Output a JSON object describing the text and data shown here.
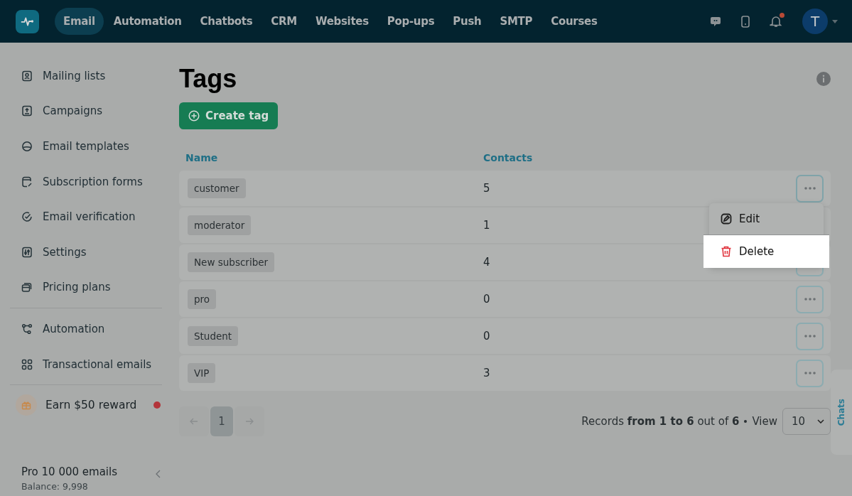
{
  "nav": [
    {
      "label": "Email",
      "selected": true
    },
    {
      "label": "Automation",
      "selected": false
    },
    {
      "label": "Chatbots",
      "selected": false
    },
    {
      "label": "CRM",
      "selected": false
    },
    {
      "label": "Websites",
      "selected": false
    },
    {
      "label": "Pop-ups",
      "selected": false
    },
    {
      "label": "Push",
      "selected": false
    },
    {
      "label": "SMTP",
      "selected": false
    },
    {
      "label": "Courses",
      "selected": false
    }
  ],
  "user": {
    "initial": "T",
    "notification": true
  },
  "sidebar": {
    "groups": [
      [
        {
          "label": "Mailing lists",
          "kind": "contacts"
        },
        {
          "label": "Campaigns",
          "kind": "upload"
        },
        {
          "label": "Email templates",
          "kind": "template"
        },
        {
          "label": "Subscription forms",
          "kind": "form"
        },
        {
          "label": "Email verification",
          "kind": "check"
        },
        {
          "label": "Settings",
          "kind": "sliders"
        },
        {
          "label": "Pricing plans",
          "kind": "cards"
        }
      ],
      [
        {
          "label": "Automation",
          "kind": "flow"
        },
        {
          "label": "Transactional emails",
          "kind": "grid"
        }
      ]
    ],
    "reward": {
      "label": "Earn $50 reward",
      "dot": true
    },
    "plan": "Pro 10 000 emails",
    "balance": "Balance: 9,998"
  },
  "page": {
    "title": "Tags",
    "create_button": "Create tag"
  },
  "table": {
    "columns": [
      "Name",
      "Contacts"
    ],
    "rows": [
      {
        "name": "customer",
        "contacts": "5",
        "menu_open": true
      },
      {
        "name": "moderator",
        "contacts": "1",
        "menu_open": false
      },
      {
        "name": "New subscriber",
        "contacts": "4",
        "menu_open": false
      },
      {
        "name": "pro",
        "contacts": "0",
        "menu_open": false
      },
      {
        "name": "Student",
        "contacts": "0",
        "menu_open": false
      },
      {
        "name": "VIP",
        "contacts": "3",
        "menu_open": false
      }
    ]
  },
  "menu": {
    "items": [
      {
        "kind": "edit",
        "label": "Edit",
        "selected": false
      },
      {
        "kind": "delete",
        "label": "Delete",
        "selected": true
      }
    ]
  },
  "pagination": {
    "pages": [
      {
        "label": "1",
        "selected": true
      }
    ],
    "records": "Records **from 1 to 6** out of **6**",
    "view_label": "View",
    "view_value": "10"
  },
  "chats_tab": "Chats"
}
